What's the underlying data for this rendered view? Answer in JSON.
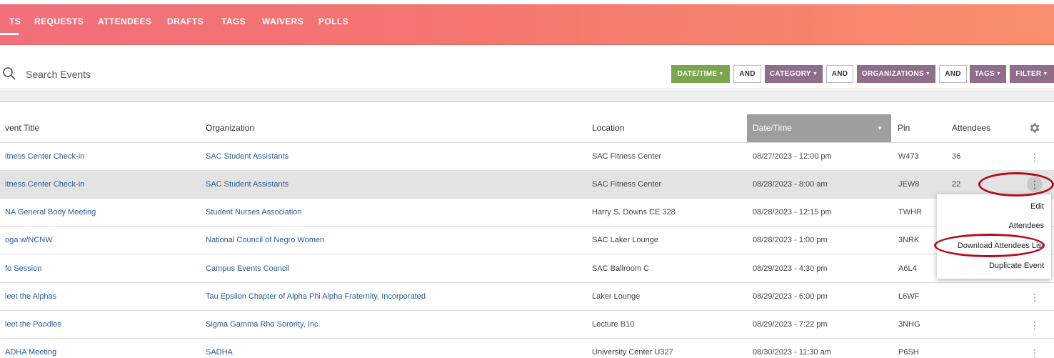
{
  "nav": {
    "tabs": [
      "TS",
      "REQUESTS",
      "ATTENDEES",
      "DRAFTS",
      "TAGS",
      "WAIVERS",
      "POLLS"
    ]
  },
  "search": {
    "placeholder": "Search Events"
  },
  "filters": {
    "datetime": "DATE/TIME",
    "and1": "AND",
    "category": "CATEGORY",
    "and2": "AND",
    "organizations": "ORGANIZATIONS",
    "and3": "AND",
    "tags": "TAGS",
    "filter": "FILTER"
  },
  "table": {
    "headers": {
      "title": "vent Title",
      "organization": "Organization",
      "location": "Location",
      "datetime": "Date/Time",
      "pin": "Pin",
      "attendees": "Attendees"
    },
    "rows": [
      {
        "title": "itness Center Check-in",
        "organization": "SAC Student Assistants",
        "location": "SAC Fitness Center",
        "datetime": "08/27/2023 - 12:00 pm",
        "pin": "W473",
        "attendees": "36"
      },
      {
        "title": "itness Center Check-in",
        "organization": "SAC Student Assistants",
        "location": "SAC Fitness Center",
        "datetime": "08/28/2023 - 8:00 am",
        "pin": "JEW8",
        "attendees": "22"
      },
      {
        "title": "NA General Body Meeting",
        "organization": "Student Nurses Association",
        "location": "Harry S. Downs CE 328",
        "datetime": "08/28/2023 - 12:15 pm",
        "pin": "TWHR",
        "attendees": ""
      },
      {
        "title": "oga w/NCNW",
        "organization": "National Council of Negro Women",
        "location": "SAC Laker Lounge",
        "datetime": "08/28/2023 - 1:00 pm",
        "pin": "3NRK",
        "attendees": ""
      },
      {
        "title": "fo Session",
        "organization": "Campus Events Council",
        "location": "SAC Ballroom C",
        "datetime": "08/29/2023 - 4:30 pm",
        "pin": "A6L4",
        "attendees": ""
      },
      {
        "title": "leet the Alphas",
        "organization": "Tau Epsilon Chapter of Alpha Phi Alpha Fraternity, Incorporated",
        "location": "Laker Lounge",
        "datetime": "08/29/2023 - 6:00 pm",
        "pin": "L6WF",
        "attendees": ""
      },
      {
        "title": "leet the Poodles",
        "organization": "Sigma Gamma Rho Sorority, Inc.",
        "location": "Lecture B10",
        "datetime": "08/29/2023 - 7:22 pm",
        "pin": "3NHG",
        "attendees": ""
      },
      {
        "title": "ADHA Meeting",
        "organization": "SADHA",
        "location": "University Center U327",
        "datetime": "08/30/2023 - 11:30 am",
        "pin": "P6SH",
        "attendees": ""
      }
    ]
  },
  "context_menu": {
    "items": [
      "Edit",
      "Attendees",
      "Download Attendees List",
      "Duplicate Event"
    ]
  },
  "icons": {
    "kebab": "more-vert-icon",
    "gear": "gear-icon",
    "search": "search-icon"
  },
  "colors": {
    "highlight_circle": "#b40d1a",
    "link": "#2a5d99",
    "date_filter": "#7ba54e",
    "other_filters": "#8e6e8a"
  }
}
